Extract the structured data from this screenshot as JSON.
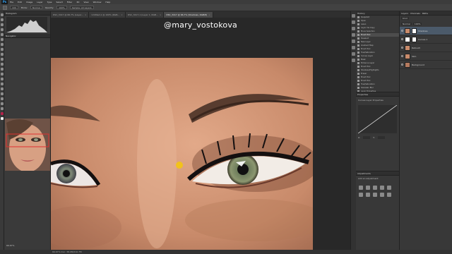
{
  "app": {
    "logo": "Ps"
  },
  "menu": [
    "File",
    "Edit",
    "Image",
    "Layer",
    "Type",
    "Select",
    "Filter",
    "3D",
    "View",
    "Window",
    "Help"
  ],
  "options": {
    "brush_size": "100",
    "mode_label": "Mode:",
    "mode_value": "Normal",
    "opacity_label": "Opacity:",
    "opacity_value": "100%",
    "sample_value": "Sample: All Layers"
  },
  "tabs": [
    {
      "label": "DSC_3417 @ 66.7% (Layer...",
      "active": false
    },
    {
      "label": "Untitled-1 @ 100% (RGB...",
      "active": false
    },
    {
      "label": "DSC_3417-1 (Layer 1, RGB...",
      "active": false
    },
    {
      "label": "DSC_3417 @ 66.7% (Shadows, RGB/8)",
      "active": true
    }
  ],
  "left_panel": {
    "histogram_title": "Histogram",
    "navigator_title": "Navigator",
    "zoom": "66.67%"
  },
  "canvas": {
    "watermark": "@mary_vostokova"
  },
  "history": {
    "title": "History",
    "items": [
      "Snapshot",
      "Open",
      "Lasso",
      "Layer Via Copy",
      "Move Selection",
      "Brush Tool",
      "Deselect",
      "New Layer",
      "Gradient Map",
      "Brush Tool",
      "Hue/Saturation",
      "Curves Layer",
      "Mask",
      "Enhance Layer",
      "Brush Tool",
      "Shadows/Highlights",
      "Eraser",
      "Brush Tool",
      "Brush Tool",
      "Hue/Saturation",
      "Gaussian Blur",
      "Layer Properties"
    ],
    "active_index": 5
  },
  "properties": {
    "title": "Properties",
    "subtitle": "Curves Layer Properties",
    "x_label": "X:",
    "y_label": "Y:"
  },
  "adjustments": {
    "title": "Adjustments",
    "subtitle": "Add an adjustment"
  },
  "layers": {
    "tabs": [
      "Layers",
      "Channels",
      "Paths"
    ],
    "kind_label": "Kind",
    "blend_mode": "Normal",
    "opacity": "100%",
    "items": [
      {
        "name": "Shadows",
        "active": true,
        "mask": true
      },
      {
        "name": "Curves 1",
        "active": false,
        "mask": true
      },
      {
        "name": "Retouch",
        "active": false,
        "mask": false
      },
      {
        "name": "Skin",
        "active": false,
        "mask": false
      },
      {
        "name": "Background",
        "active": false,
        "mask": false
      }
    ]
  },
  "status": {
    "text": "66.67%     Doc: 38.9M/210.7M"
  },
  "colors": {
    "fg": "#b3224a",
    "bg": "#eeeeee",
    "accent": "#31a8ff"
  }
}
